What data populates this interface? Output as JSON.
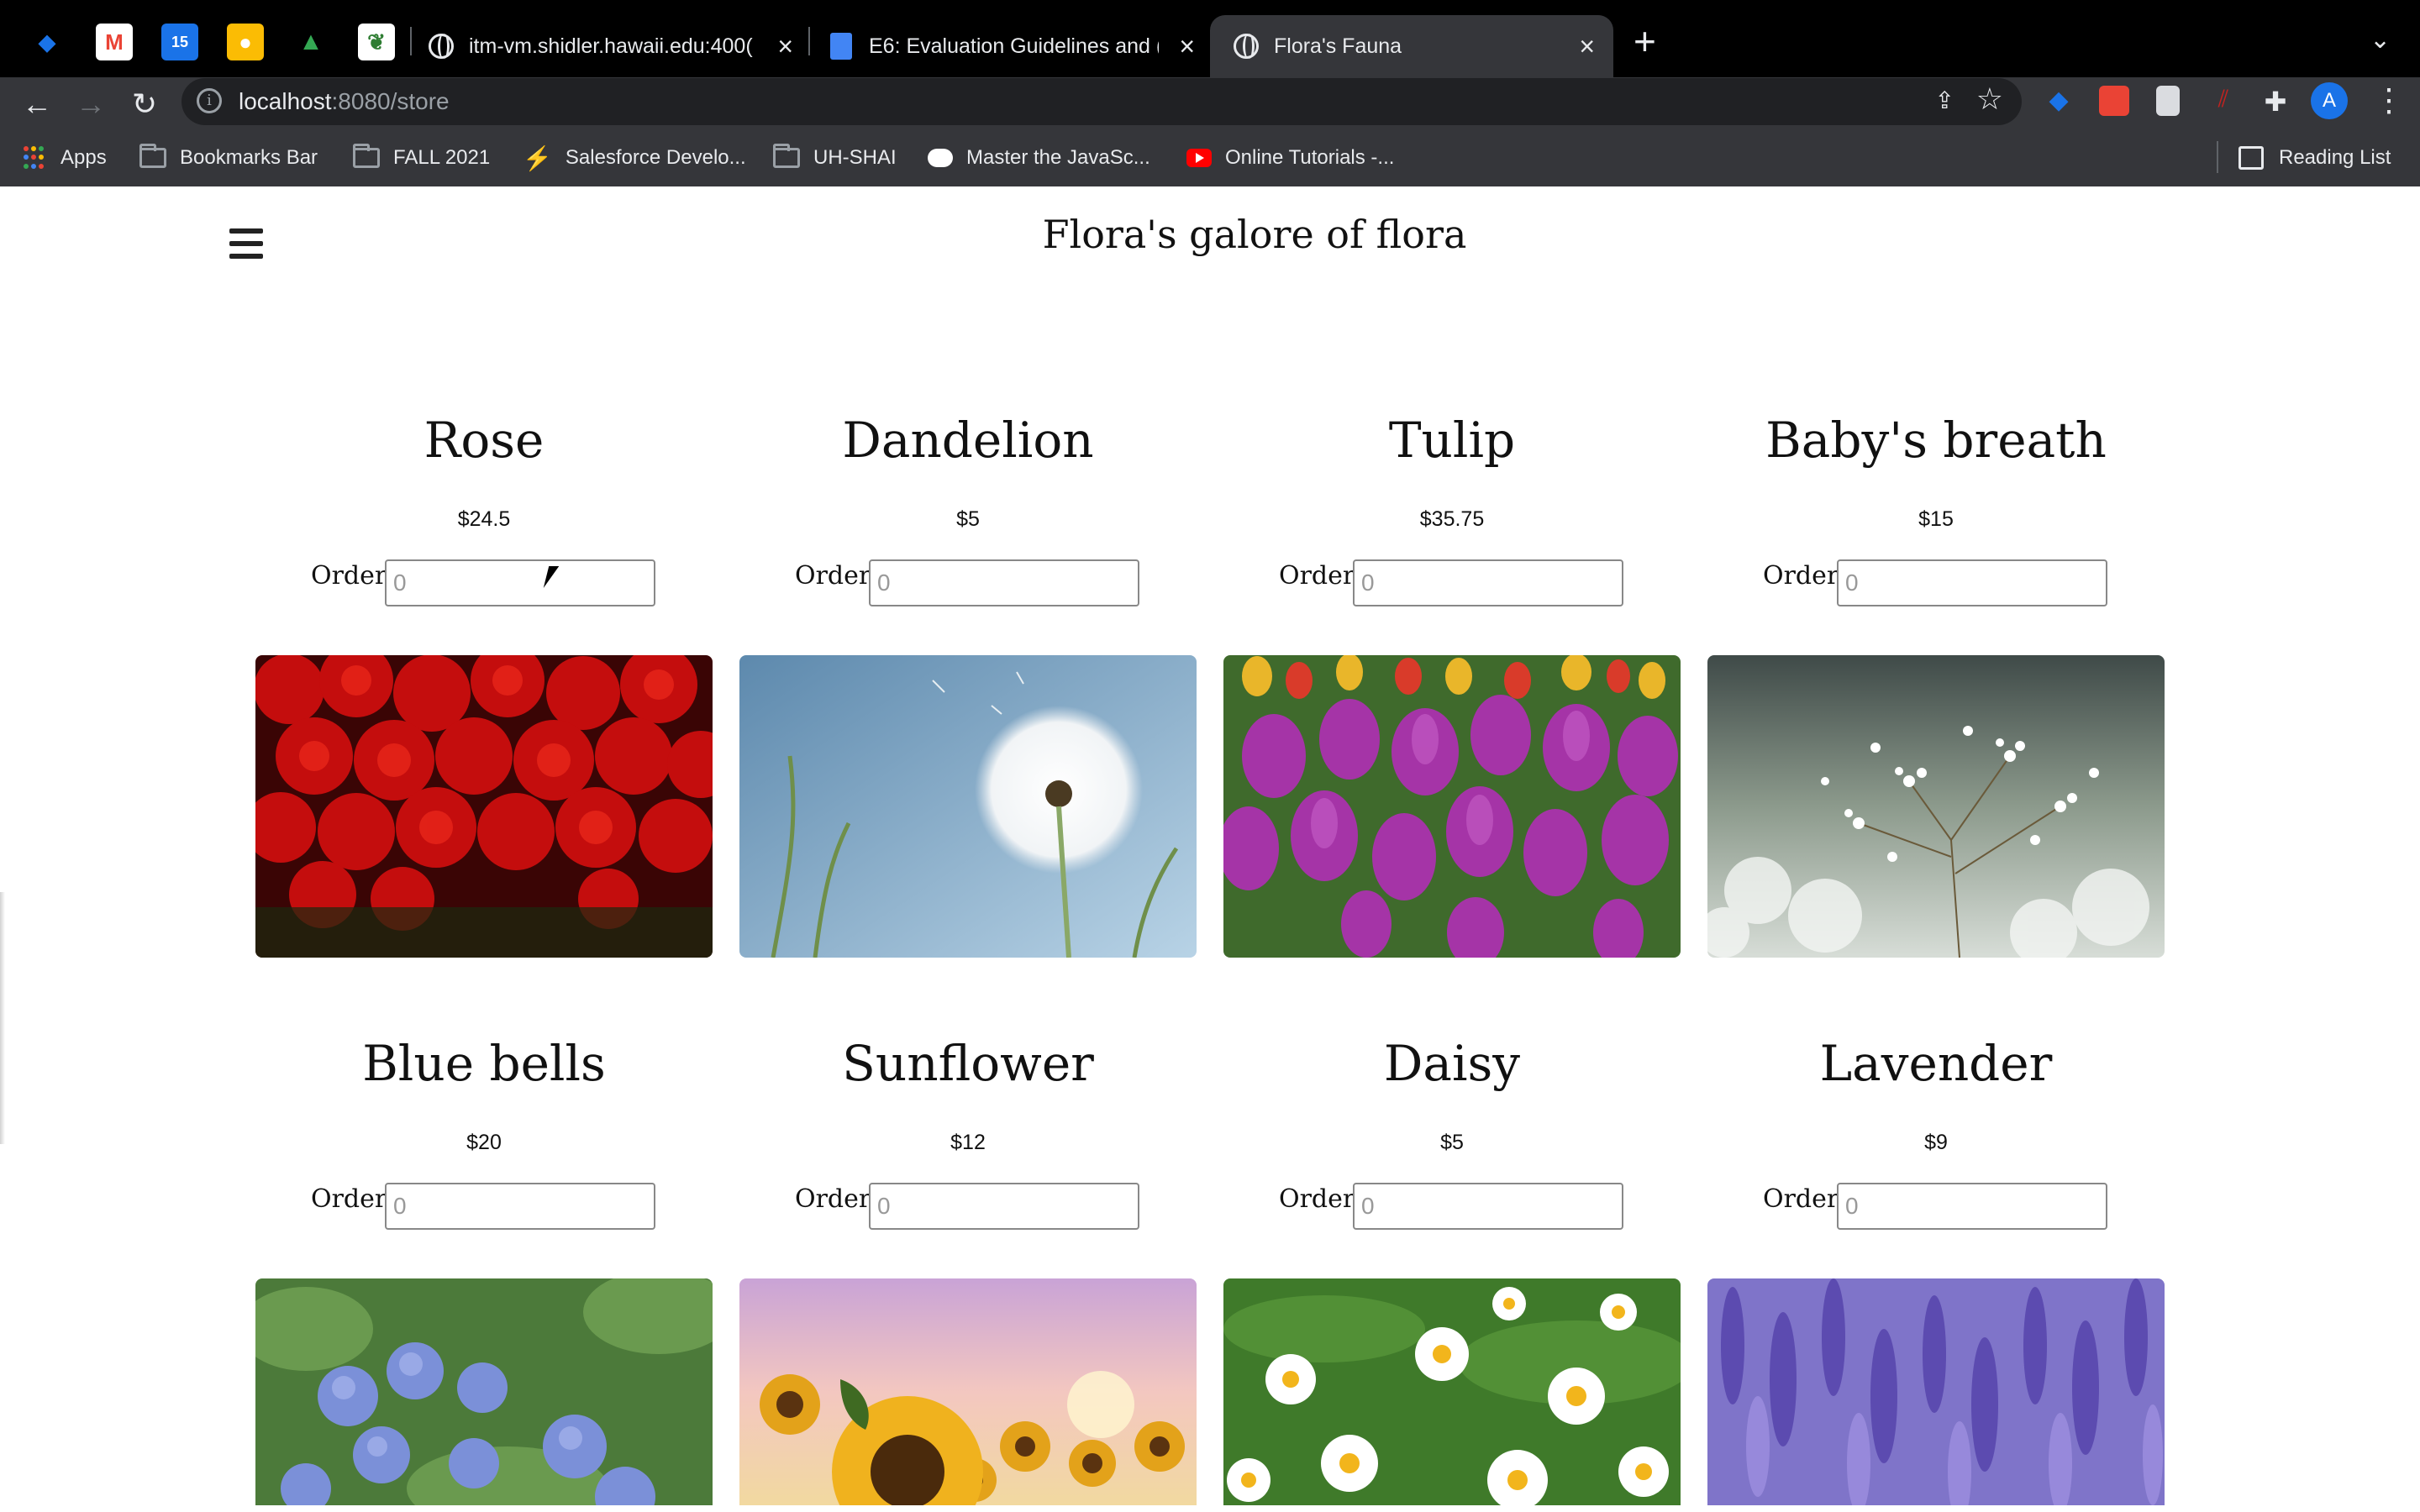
{
  "browser": {
    "tabs": [
      {
        "label": "itm-vm.shidler.hawaii.edu:400(",
        "icon": "globe-icon"
      },
      {
        "label": "E6: Evaluation Guidelines and (",
        "icon": "google-docs-icon"
      },
      {
        "label": "Flora's Fauna",
        "icon": "globe-icon",
        "active": true
      }
    ],
    "new_tab_symbol": "+",
    "address": {
      "host": "localhost",
      "path": ":8080/store"
    },
    "profile_initial": "A",
    "bookmarks": [
      {
        "label": "Apps",
        "icon": "apps-grid-icon"
      },
      {
        "label": "Bookmarks Bar",
        "icon": "folder-icon"
      },
      {
        "label": "FALL 2021",
        "icon": "folder-icon"
      },
      {
        "label": "Salesforce Develo...",
        "icon": "salesforce-bolt-icon"
      },
      {
        "label": "UH-SHAI",
        "icon": "folder-icon"
      },
      {
        "label": "Master the JavaSc...",
        "icon": "medium-icon"
      },
      {
        "label": "Online Tutorials -...",
        "icon": "youtube-icon"
      }
    ],
    "reading_list": "Reading List"
  },
  "site": {
    "title": "Flora's galore of flora",
    "order_label": "Order:",
    "order_placeholder": "0",
    "products": [
      {
        "name": "Rose",
        "price": "$24.5"
      },
      {
        "name": "Dandelion",
        "price": "$5"
      },
      {
        "name": "Tulip",
        "price": "$35.75"
      },
      {
        "name": "Baby's breath",
        "price": "$15"
      },
      {
        "name": "Blue bells",
        "price": "$20"
      },
      {
        "name": "Sunflower",
        "price": "$12"
      },
      {
        "name": "Daisy",
        "price": "$5"
      },
      {
        "name": "Lavender",
        "price": "$9"
      }
    ]
  },
  "colors": {
    "chrome_dark": "#202124",
    "toolbar": "#35363a",
    "page_bg": "#ffffff",
    "text": "#111111"
  }
}
